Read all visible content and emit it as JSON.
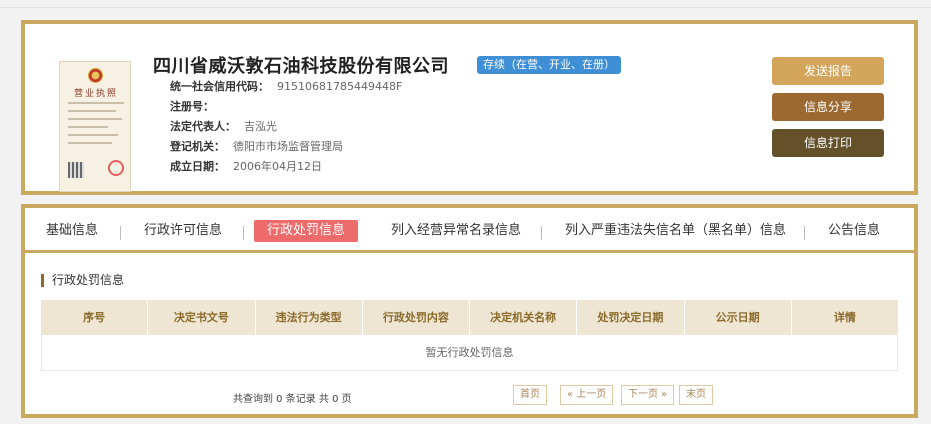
{
  "company": {
    "name": "四川省威沃敦石油科技股份有限公司",
    "status": "存续（在营、开业、在册）",
    "license_title": "营业执照",
    "fields": [
      {
        "label": "统一社会信用代码：",
        "value": "91510681785449448F"
      },
      {
        "label": "注册号：",
        "value": ""
      },
      {
        "label": "法定代表人：",
        "value": "吉泓光"
      },
      {
        "label": "登记机关：",
        "value": "德阳市市场监督管理局"
      },
      {
        "label": "成立日期：",
        "value": "2006年04月12日"
      }
    ]
  },
  "actions": {
    "report": "发送报告",
    "share": "信息分享",
    "print": "信息打印"
  },
  "tabs": [
    "基础信息",
    "行政许可信息",
    "行政处罚信息",
    "列入经营异常名录信息",
    "列入严重违法失信名单（黑名单）信息",
    "公告信息"
  ],
  "section": {
    "title": "行政处罚信息",
    "columns": [
      "序号",
      "决定书文号",
      "违法行为类型",
      "行政处罚内容",
      "决定机关名称",
      "处罚决定日期",
      "公示日期",
      "详情"
    ],
    "empty_text": "暂无行政处罚信息"
  },
  "pagination": {
    "summary": "共查询到 0 条记录 共 0 页",
    "first": "首页",
    "prev": "« 上一页",
    "next": "下一页 »",
    "last": "末页"
  },
  "colors": {
    "border_gold": "#c9a960",
    "status_blue": "#3f8fd6",
    "active_tab": "#ee6b6b",
    "btn_report": "#d2a55a",
    "btn_share": "#9c6a30",
    "btn_print": "#64512a"
  }
}
